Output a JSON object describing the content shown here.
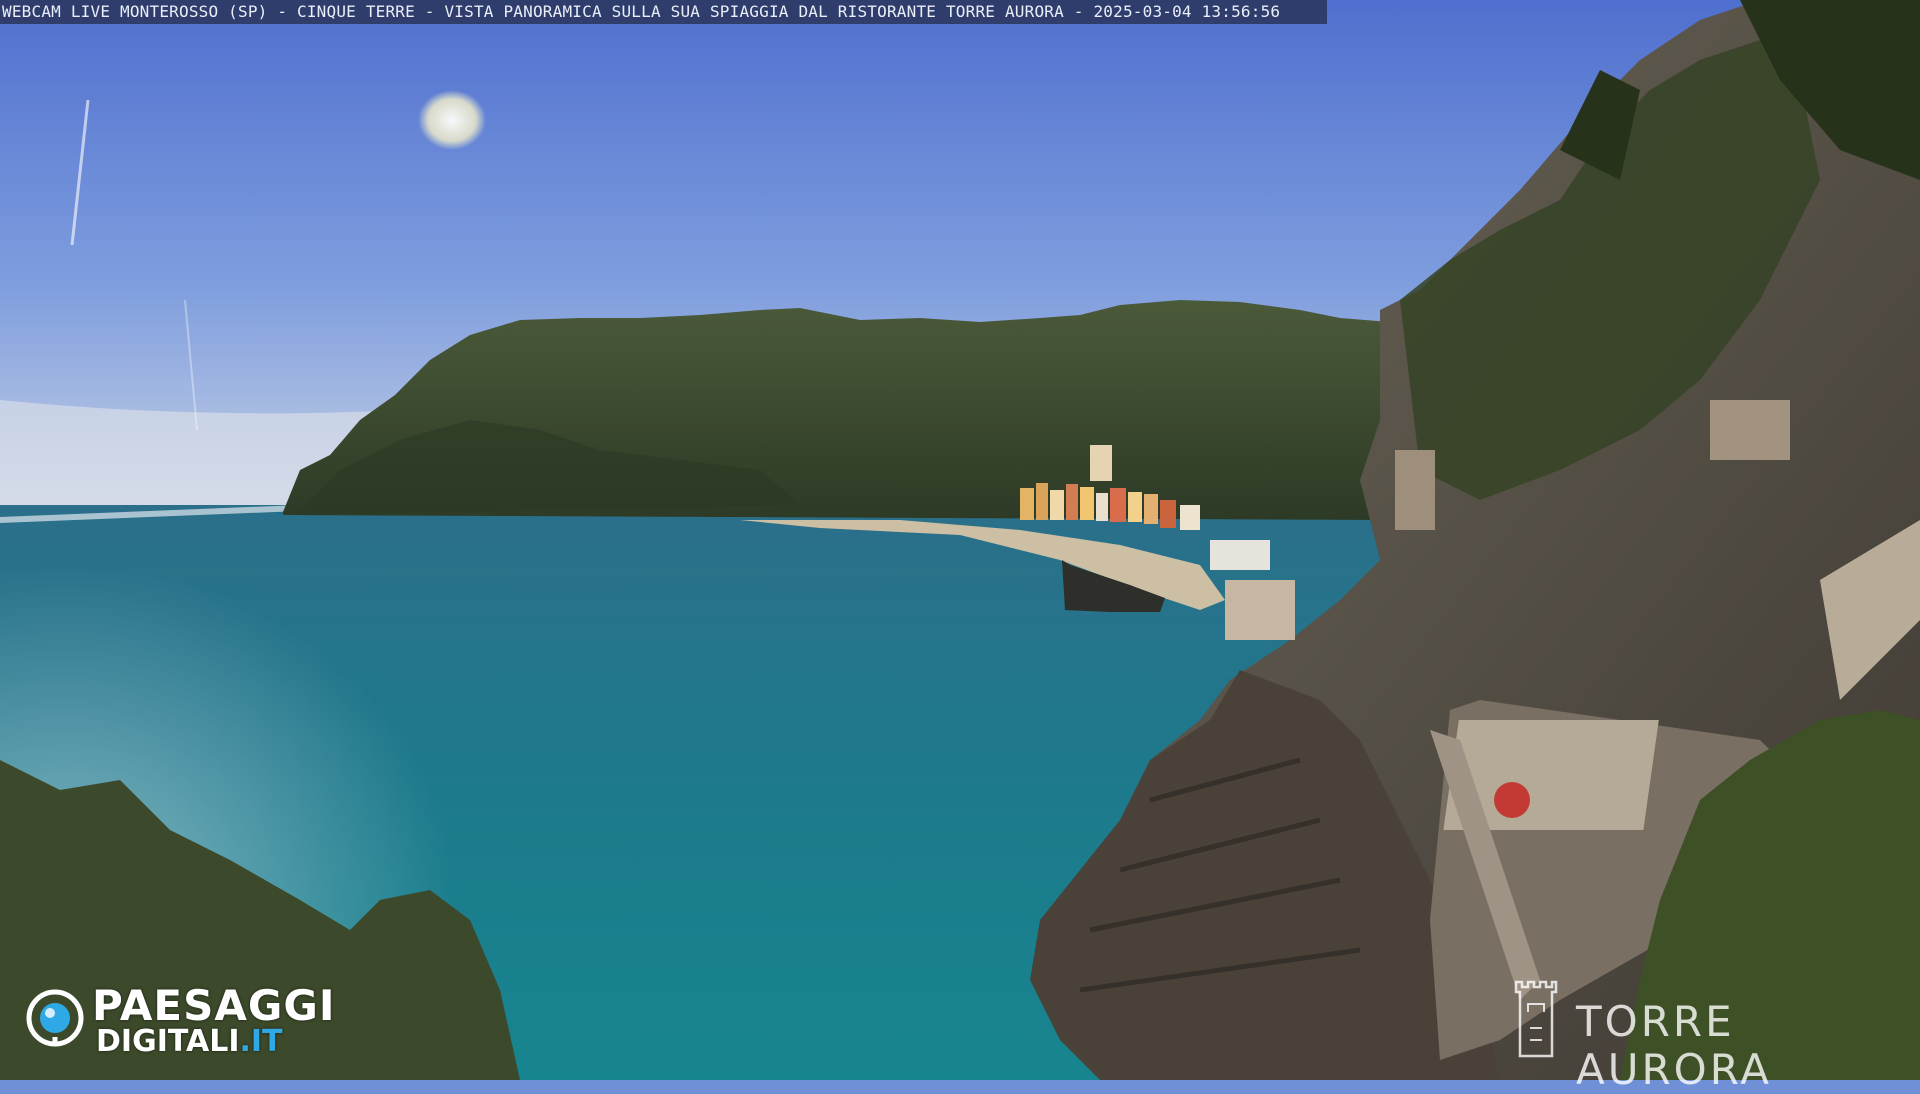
{
  "overlay": {
    "title_bar_text": "WEBCAM LIVE MONTEROSSO (SP) - CINQUE TERRE - VISTA PANORAMICA SULLA SUA SPIAGGIA DAL RISTORANTE TORRE AURORA - 2025-03-04 13:56:56"
  },
  "logo": {
    "line1": "PAESAGGI",
    "line2_main": "DIGITALI",
    "line2_tld": ".IT",
    "tld_color": "#2fa9e6"
  },
  "watermark": {
    "text": "TORRE AURORA",
    "icon": "tower-icon"
  },
  "scene": {
    "sky_color": "#6d8fd8",
    "sea_color": "#1f7388",
    "headland_color": "#3a4a2c",
    "cliff_color": "#5b5448"
  }
}
